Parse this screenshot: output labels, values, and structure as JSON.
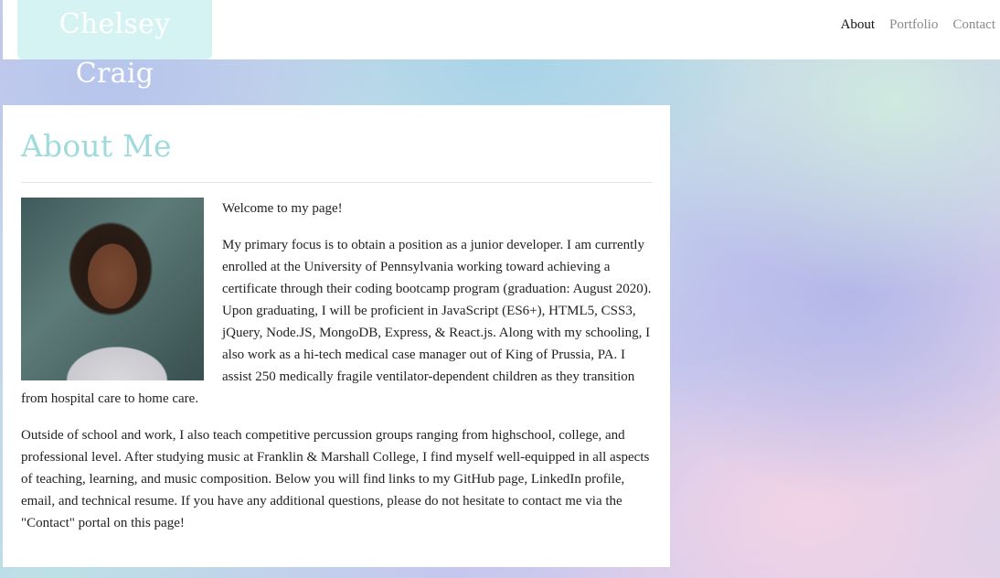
{
  "header": {
    "brand": "Chelsey Craig",
    "nav": [
      {
        "label": "About",
        "active": true
      },
      {
        "label": "Portfolio",
        "active": false
      },
      {
        "label": "Contact",
        "active": false
      }
    ]
  },
  "about": {
    "title": "About Me",
    "photo_alt": "profile photo",
    "paragraphs": [
      "Welcome to my page!",
      "My primary focus is to obtain a position as a junior developer. I am currently enrolled at the University of Pennsylvania working toward achieving a certificate through their coding bootcamp program (graduation: August 2020). Upon graduating, I will be proficient in JavaScript (ES6+), HTML5, CSS3, jQuery, Node.JS, MongoDB, Express, & React.js. Along with my schooling, I also work as a hi-tech medical case manager out of King of Prussia, PA. I assist 250 medically fragile ventilator-dependent children as they transition from hospital care to home care.",
      "Outside of school and work, I also teach competitive percussion groups ranging from highschool, college, and professional level. After studying music at Franklin & Marshall College, I find myself well-equipped in all aspects of teaching, learning, and music composition. Below you will find links to my GitHub page, LinkedIn profile, email, and technical resume. If you have any additional questions, please do not hesitate to contact me via the \"Contact\" portal on this page!"
    ]
  },
  "colors": {
    "brand_bg": "#d5f3f3",
    "heading": "#9fdbdc",
    "nav_active": "#111111",
    "nav_inactive": "#8a8a8a"
  }
}
